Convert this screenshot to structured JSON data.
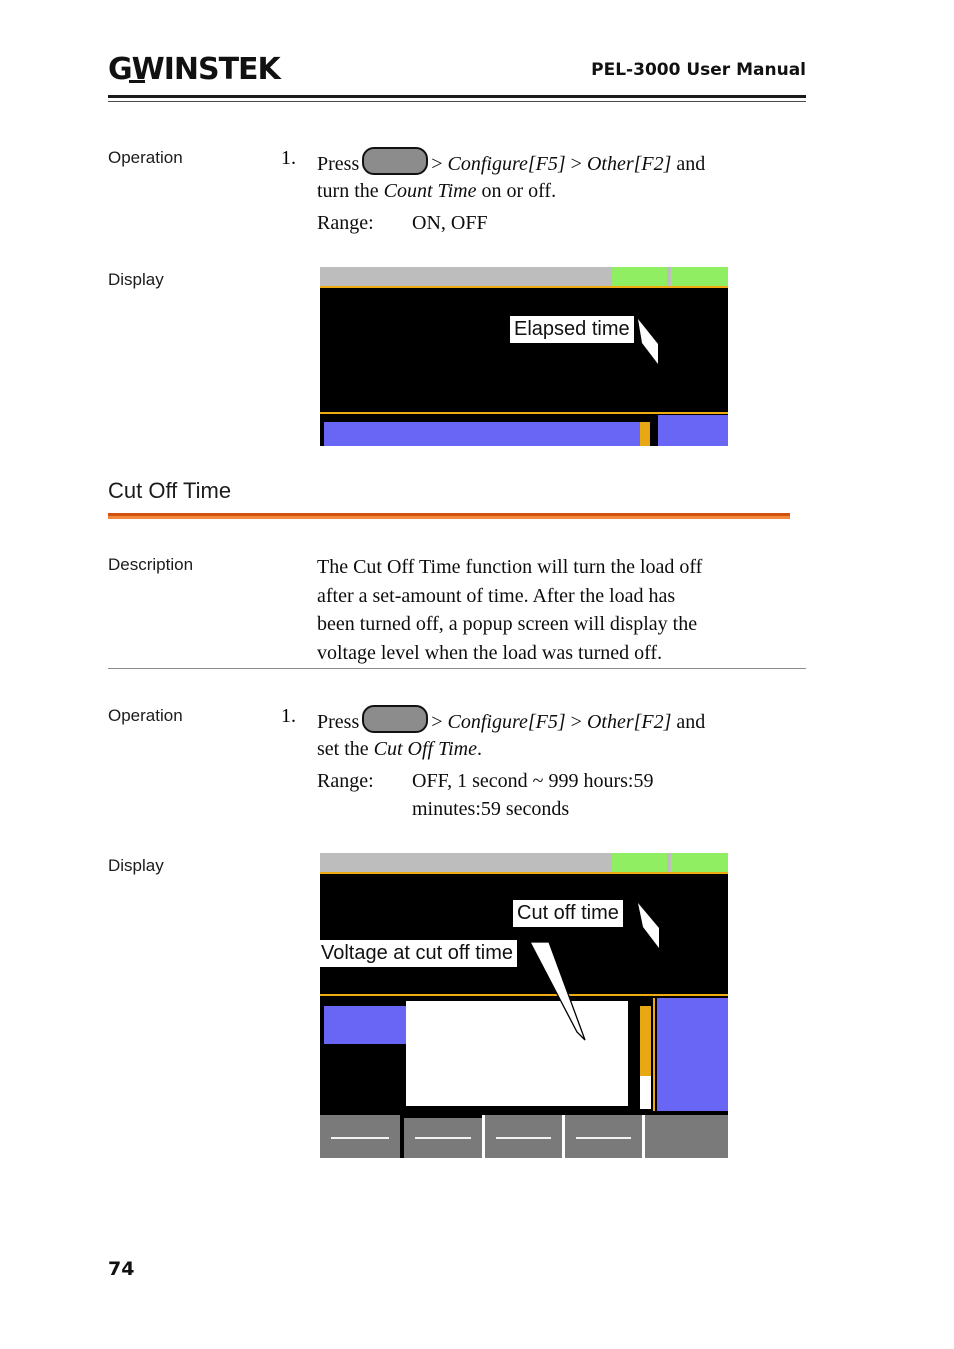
{
  "header": {
    "logo_gw": "G",
    "logo_w": "W",
    "logo_rest": "INSTEK",
    "title": "PEL-3000 User Manual"
  },
  "sections": [
    {
      "id": "count-time-operation",
      "label": "Operation",
      "step_number": "1.",
      "line1_pre": "Press",
      "key_icon": "rounded-key-icon",
      "line1_post_a": "> ",
      "line1_italic_a": "Configure[F5]",
      "line1_sep": " > ",
      "line1_italic_b": "Other[F2]",
      "line1_tail": " and",
      "line2_pre": "turn the ",
      "line2_italic": "Count Time",
      "line2_post": " on or off.",
      "range_label": "Range:",
      "range_value": "ON, OFF"
    },
    {
      "id": "cut-off-time-operation",
      "label": "Operation",
      "step_number": "1.",
      "line1_pre": "Press",
      "key_icon": "rounded-key-icon",
      "line1_post_a": "> ",
      "line1_italic_a": "Configure[F5]",
      "line1_sep": " > ",
      "line1_italic_b": "Other[F2]",
      "line1_tail": " and",
      "line2_pre": "set the ",
      "line2_italic": "Cut Off Time",
      "line2_post": ".",
      "range_label": "Range:",
      "range_value": "OFF, 1 second ~ 999 hours:59",
      "range_value2": "minutes:59 seconds"
    }
  ],
  "display_rows": [
    {
      "id": "display-count-time",
      "label": "Display"
    },
    {
      "id": "display-cut-off-time",
      "label": "Display"
    }
  ],
  "heading": {
    "text": "Cut Off Time",
    "rule_color_top": "#d4500f",
    "rule_color_bottom": "#f08a3c"
  },
  "description": {
    "label": "Description",
    "line1": "The Cut Off Time function will turn the load off",
    "line2": "after a set-amount of time. After the load has",
    "line3": "been turned off, a popup screen will display the",
    "line4": "voltage level when the load was turned off."
  },
  "callouts": {
    "elapsed_time": "Elapsed time",
    "cut_off_time": "Cut off time",
    "voltage_at_cut_off_time": "Voltage at cut off time"
  },
  "lcd_colors": {
    "screen_black": "#000000",
    "top_bar_gray": "#bdbdbd",
    "status_green": "#90ee62",
    "accent_gold": "#f0ab10",
    "bar_blue": "#6a66f5",
    "meter_amber": "#f5ae12",
    "fkey_gray": "#7a7a7a",
    "popup_white": "#ffffff"
  },
  "footer": {
    "page_number": "74"
  }
}
